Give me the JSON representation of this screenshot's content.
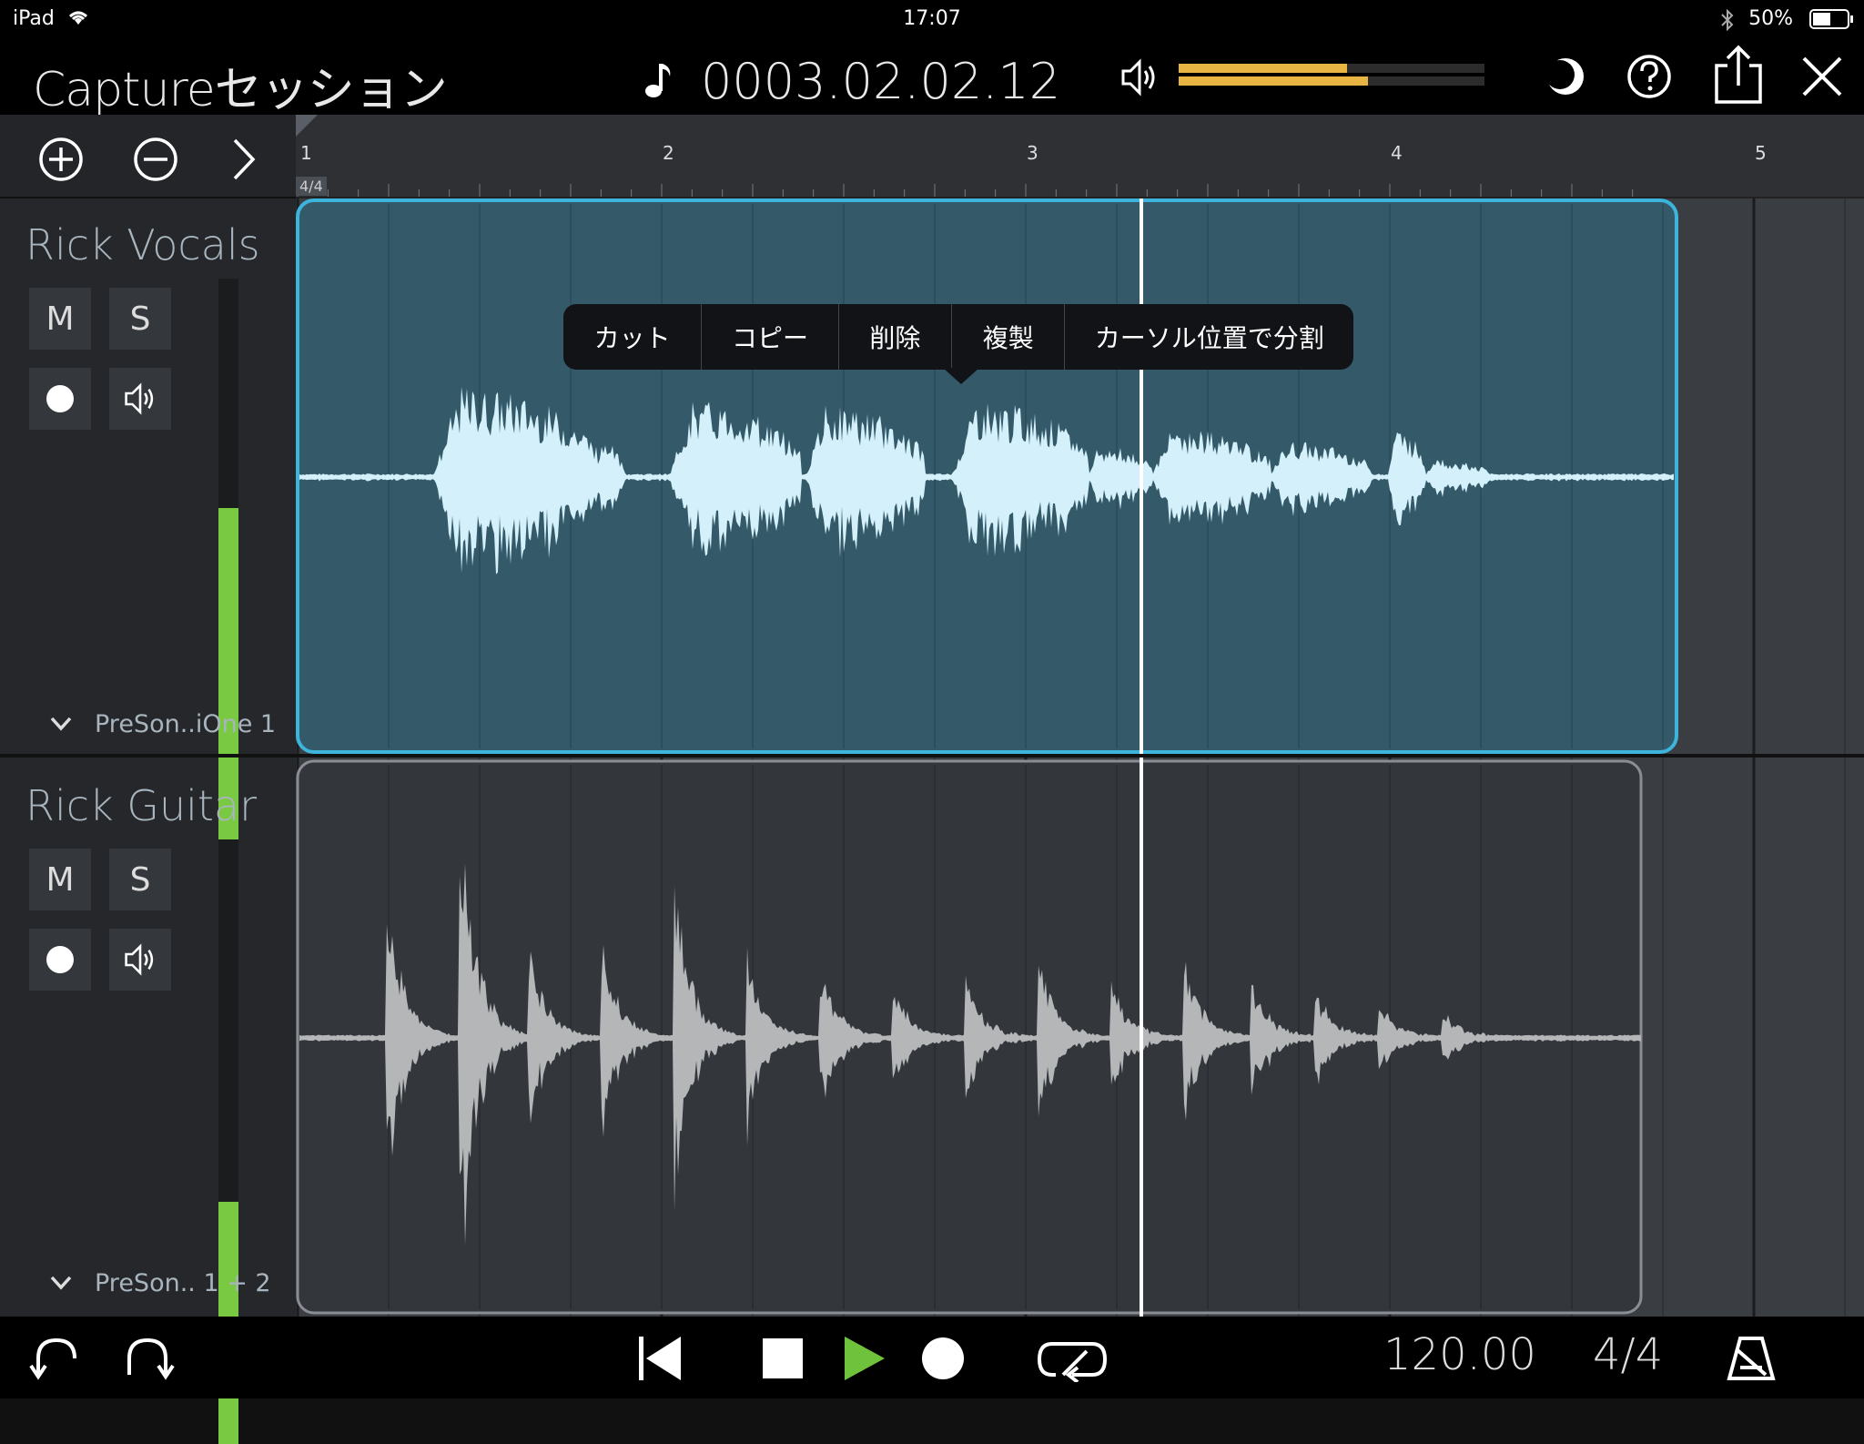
{
  "status_bar": {
    "device": "iPad",
    "time": "17:07",
    "battery": "50%"
  },
  "header": {
    "title": "Captureセッション",
    "timecode": "0003.02.02.12",
    "volume_levels": [
      0.55,
      0.62
    ],
    "icons": [
      "metronome-note-icon",
      "speaker-icon",
      "theme-icon",
      "help-icon",
      "share-icon",
      "close-icon"
    ]
  },
  "toolbar": {
    "icons": [
      "add-track-icon",
      "remove-track-icon",
      "expand-icon"
    ]
  },
  "ruler": {
    "bars": [
      "1",
      "2",
      "3",
      "4",
      "5"
    ],
    "time_signature": "4/4"
  },
  "tracks": [
    {
      "name": "Rick Vocals",
      "mute_label": "M",
      "solo_label": "S",
      "input": "PreSon..iOne 1",
      "level": 0.62,
      "selected": true
    },
    {
      "name": "Rick Guitar",
      "mute_label": "M",
      "solo_label": "S",
      "input": "PreSon.. 1 + 2",
      "level": 0.4,
      "selected": false
    }
  ],
  "context_menu": [
    "カット",
    "コピー",
    "削除",
    "複製",
    "カーソル位置で分割"
  ],
  "transport": {
    "tempo": "120.00",
    "time_signature": "4/4",
    "icons": [
      "undo-icon",
      "redo-icon",
      "rewind-icon",
      "stop-icon",
      "play-icon",
      "record-icon",
      "loop-icon",
      "metronome-icon"
    ]
  },
  "colors": {
    "accent": "#3cb4dc",
    "meter_green": "#7ac943",
    "meter_yellow": "#e8b545",
    "play_green": "#6fc23c"
  }
}
